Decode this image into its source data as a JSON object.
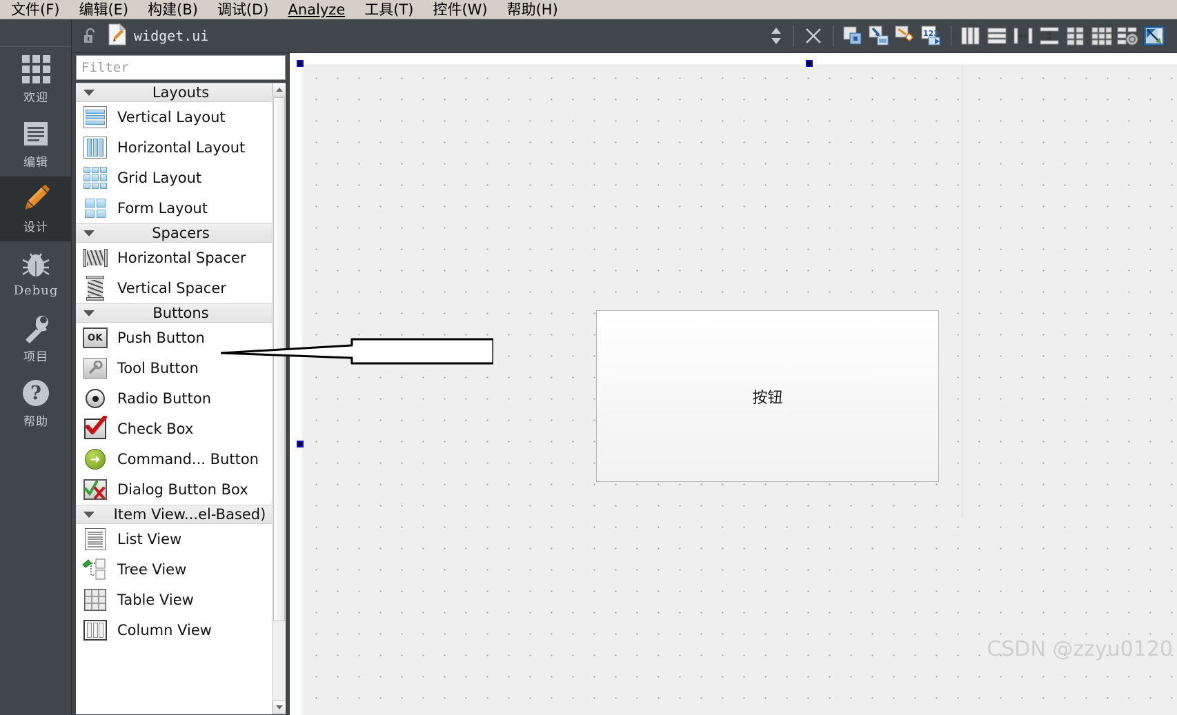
{
  "menubar": {
    "items": [
      {
        "label": "文件(F)",
        "mnemonic": "F"
      },
      {
        "label": "编辑(E)",
        "mnemonic": "E"
      },
      {
        "label": "构建(B)",
        "mnemonic": "B"
      },
      {
        "label": "调试(D)",
        "mnemonic": "D"
      },
      {
        "label": "Analyze",
        "mnemonic": "A"
      },
      {
        "label": "工具(T)",
        "mnemonic": "T"
      },
      {
        "label": "控件(W)",
        "mnemonic": "W"
      },
      {
        "label": "帮助(H)",
        "mnemonic": "H"
      }
    ]
  },
  "modebar": {
    "items": [
      {
        "label": "欢迎",
        "icon": "grid-icon",
        "active": false
      },
      {
        "label": "编辑",
        "icon": "document-icon",
        "active": false
      },
      {
        "label": "设计",
        "icon": "pencil-icon",
        "active": true
      },
      {
        "label": "Debug",
        "icon": "bug-icon",
        "active": false
      },
      {
        "label": "项目",
        "icon": "wrench-icon",
        "active": false
      },
      {
        "label": "帮助",
        "icon": "question-icon",
        "active": false
      }
    ]
  },
  "toolbar": {
    "lock_icon": "unlocked-padlock-icon",
    "file_icon": "ui-file-icon",
    "filename": "widget.ui",
    "nav_icon": "up-down-arrows-icon",
    "close_icon": "close-x-icon",
    "buttons": [
      {
        "name": "edit-widgets",
        "title": "Edit Widgets"
      },
      {
        "name": "edit-signals-slots",
        "title": "Edit Signals/Slots"
      },
      {
        "name": "edit-buddies",
        "title": "Edit Buddies"
      },
      {
        "name": "edit-tab-order",
        "title": "Edit Tab Order"
      },
      {
        "name": "layout-horizontally",
        "title": "Lay Out Horizontally"
      },
      {
        "name": "layout-vertically",
        "title": "Lay Out Vertically"
      },
      {
        "name": "layout-splitter-horizontal",
        "title": "Lay Out Horizontally in Splitter"
      },
      {
        "name": "layout-splitter-vertical",
        "title": "Lay Out Vertically in Splitter"
      },
      {
        "name": "layout-form",
        "title": "Lay Out in a Form Layout"
      },
      {
        "name": "layout-grid",
        "title": "Lay Out in a Grid"
      },
      {
        "name": "break-layout",
        "title": "Break Layout"
      },
      {
        "name": "adjust-size",
        "title": "Adjust Size"
      }
    ]
  },
  "widgetbox": {
    "filter": {
      "value": "",
      "placeholder": "Filter"
    },
    "sections": [
      {
        "title": "Layouts",
        "expanded": true,
        "items": [
          {
            "label": "Vertical Layout",
            "icon": "vertical-layout-icon"
          },
          {
            "label": "Horizontal Layout",
            "icon": "horizontal-layout-icon"
          },
          {
            "label": "Grid Layout",
            "icon": "grid-layout-icon"
          },
          {
            "label": "Form Layout",
            "icon": "form-layout-icon"
          }
        ]
      },
      {
        "title": "Spacers",
        "expanded": true,
        "items": [
          {
            "label": "Horizontal Spacer",
            "icon": "horizontal-spacer-icon"
          },
          {
            "label": "Vertical Spacer",
            "icon": "vertical-spacer-icon"
          }
        ]
      },
      {
        "title": "Buttons",
        "expanded": true,
        "items": [
          {
            "label": "Push Button",
            "icon": "push-button-icon"
          },
          {
            "label": "Tool Button",
            "icon": "tool-button-icon"
          },
          {
            "label": "Radio Button",
            "icon": "radio-button-icon"
          },
          {
            "label": "Check Box",
            "icon": "check-box-icon"
          },
          {
            "label": "Command... Button",
            "icon": "command-link-button-icon"
          },
          {
            "label": "Dialog Button Box",
            "icon": "dialog-button-box-icon"
          }
        ]
      },
      {
        "title": "Item View...el-Based)",
        "expanded": true,
        "items": [
          {
            "label": "List View",
            "icon": "list-view-icon"
          },
          {
            "label": "Tree View",
            "icon": "tree-view-icon"
          },
          {
            "label": "Table View",
            "icon": "table-view-icon"
          },
          {
            "label": "Column View",
            "icon": "column-view-icon"
          }
        ]
      }
    ]
  },
  "canvas": {
    "widget": {
      "label": "按钮",
      "type": "push-button"
    },
    "selection_handles": 3,
    "watermark": "CSDN @zzyu0120"
  },
  "colors": {
    "menubar_bg": "#d4d0c8",
    "modebar_bg": "#41464a",
    "modebar_active_bg": "#2e3134",
    "accent_orange": "#d2801f",
    "canvas_bg": "#efefef",
    "selection_blue": "#1010c0",
    "panel_white": "#ffffff"
  }
}
